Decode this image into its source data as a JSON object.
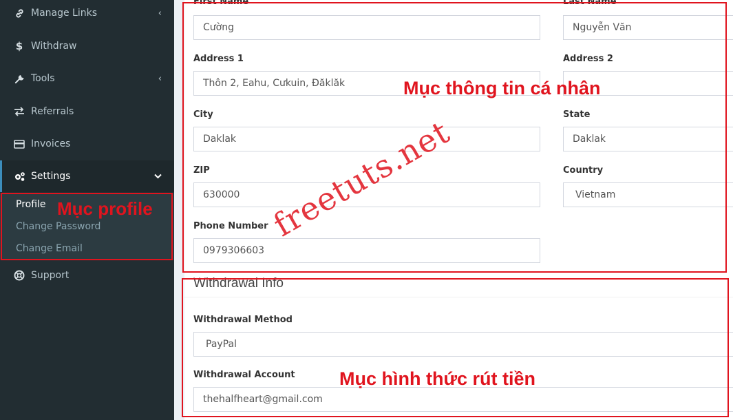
{
  "sidebar": {
    "items": [
      {
        "label": "Manage Links",
        "icon": "link-icon",
        "chevron": "‹"
      },
      {
        "label": "Withdraw",
        "icon": "dollar-icon",
        "chevron": ""
      },
      {
        "label": "Tools",
        "icon": "wrench-icon",
        "chevron": "‹"
      },
      {
        "label": "Referrals",
        "icon": "exchange-icon",
        "chevron": ""
      },
      {
        "label": "Invoices",
        "icon": "credit-card-icon",
        "chevron": ""
      },
      {
        "label": "Settings",
        "icon": "gears-icon",
        "chevron": "⌄"
      },
      {
        "label": "Support",
        "icon": "life-ring-icon",
        "chevron": ""
      }
    ],
    "submenu": [
      "Profile",
      "Change Password",
      "Change Email"
    ]
  },
  "annotations": {
    "profile": "Mục profile",
    "personal_info": "Mục thông tin cá nhân",
    "withdraw_method": "Mục hình thức rút tiền",
    "watermark": "freetuts.net"
  },
  "form": {
    "first_name": {
      "label": "First Name",
      "value": "Cường"
    },
    "last_name": {
      "label": "Last Name",
      "value": "Nguyễn Văn"
    },
    "address1": {
      "label": "Address 1",
      "value": "Thôn 2, Eahu, Cưkuin, Đăklăk"
    },
    "address2": {
      "label": "Address 2",
      "value": ""
    },
    "city": {
      "label": "City",
      "value": "Daklak"
    },
    "state": {
      "label": "State",
      "value": "Daklak"
    },
    "zip": {
      "label": "ZIP",
      "value": "630000"
    },
    "country": {
      "label": "Country",
      "value": "Vietnam"
    },
    "phone": {
      "label": "Phone Number",
      "value": "0979306603"
    }
  },
  "withdrawal": {
    "title": "Withdrawal Info",
    "method": {
      "label": "Withdrawal Method",
      "value": "PayPal"
    },
    "account": {
      "label": "Withdrawal Account",
      "value": "thehalfheart@gmail.com"
    }
  },
  "colors": {
    "sidebar": "#222d32",
    "annotation_red": "#e0141e",
    "active_accent": "#3c8dbc"
  }
}
